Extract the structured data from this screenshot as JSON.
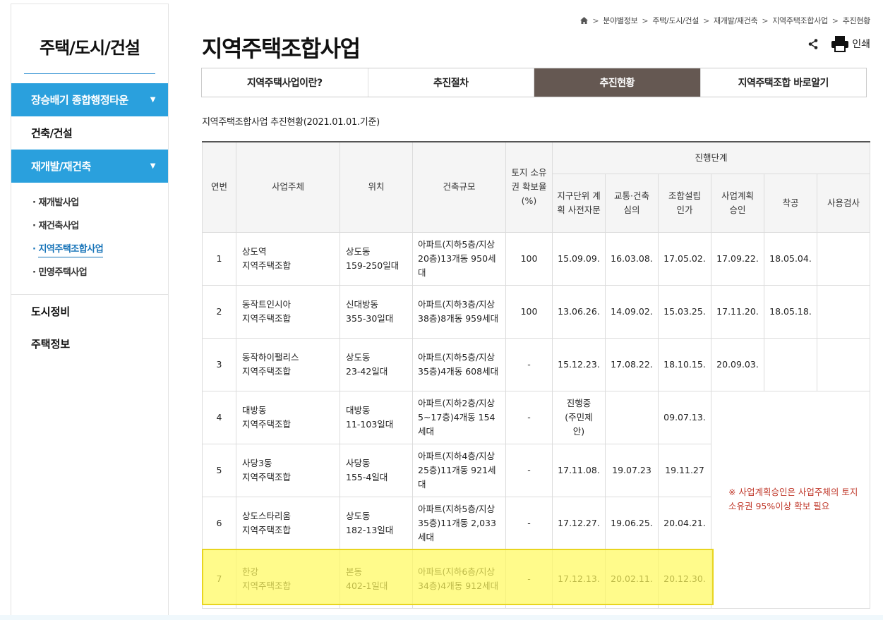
{
  "sidebar": {
    "title": "주택/도시/건설",
    "menu": [
      {
        "label": "장승배기 종합행정타운",
        "caret": "▼"
      },
      {
        "label": "건축/건설"
      },
      {
        "label": "재개발/재건축",
        "caret": "▼"
      }
    ],
    "submenu": [
      "재개발사업",
      "재건축사업",
      "지역주택조합사업",
      "민영주택사업"
    ],
    "bottom": [
      "도시정비",
      "주택정보"
    ]
  },
  "breadcrumb": [
    "분야별정보",
    "주택/도시/건설",
    "재개발/재건축",
    "지역주택조합사업",
    "추진현황"
  ],
  "page_title": "지역주택조합사업",
  "tools": {
    "print_label": "인쇄"
  },
  "tabs": [
    "지역주택사업이란?",
    "추진절차",
    "추진현황",
    "지역주택조합 바로알기"
  ],
  "caption": "지역주택조합사업 추진현황(2021.01.01.기준)",
  "table": {
    "headers": {
      "no": "연번",
      "owner": "사업주체",
      "location": "위치",
      "scale": "건축규모",
      "land": "토지 소유권 확보율 (%)",
      "stage": "진행단계",
      "stages": [
        "지구단위 계획 사전자문",
        "교통·건축 심의",
        "조합설립 인가",
        "사업계획 승인",
        "착공",
        "사용검사"
      ]
    },
    "rows": [
      {
        "no": "1",
        "owner1": "상도역",
        "owner2": "지역주택조합",
        "loc1": "상도동",
        "loc2": "159-250일대",
        "scale": "아파트(지하5층/지상20층)13개동 950세대",
        "land": "100",
        "s1": "15.09.09.",
        "s2": "16.03.08.",
        "s3": "17.05.02.",
        "s4": "17.09.22.",
        "s5": "18.05.04.",
        "s6": ""
      },
      {
        "no": "2",
        "owner1": "동작트인시아",
        "owner2": "지역주택조합",
        "loc1": "신대방동",
        "loc2": "355-30일대",
        "scale": "아파트(지하3층/지상38층)8개동 959세대",
        "land": "100",
        "s1": "13.06.26.",
        "s2": "14.09.02.",
        "s3": "15.03.25.",
        "s4": "17.11.20.",
        "s5": "18.05.18.",
        "s6": ""
      },
      {
        "no": "3",
        "owner1": "동작하이팰리스",
        "owner2": "지역주택조합",
        "loc1": "상도동",
        "loc2": "23-42일대",
        "scale": "아파트(지하5층/지상35층)4개동 608세대",
        "land": "-",
        "s1": "15.12.23.",
        "s2": "17.08.22.",
        "s3": "18.10.15.",
        "s4": "20.09.03.",
        "s5": "",
        "s6": ""
      },
      {
        "no": "4",
        "owner1": "대방동",
        "owner2": "지역주택조합",
        "loc1": "대방동",
        "loc2": "11-103일대",
        "scale": "아파트(지하2층/지상5~17층)4개동 154세대",
        "land": "-",
        "s1": "진행중 (주민제안)",
        "s2": "",
        "s3": "09.07.13."
      },
      {
        "no": "5",
        "owner1": "사당3동",
        "owner2": "지역주택조합",
        "loc1": "사당동",
        "loc2": "155-4일대",
        "scale": "아파트(지하4층/지상25층)11개동 921세대",
        "land": "-",
        "s1": "17.11.08.",
        "s2": "19.07.23",
        "s3": "19.11.27"
      },
      {
        "no": "6",
        "owner1": "상도스타리움",
        "owner2": "지역주택조합",
        "loc1": "상도동",
        "loc2": "182-13일대",
        "scale": "아파트(지하5층/지상35층)11개동 2,033세대",
        "land": "-",
        "s1": "17.12.27.",
        "s2": "19.06.25.",
        "s3": "20.04.21."
      },
      {
        "no": "7",
        "owner1": "한강",
        "owner2": "지역주택조합",
        "loc1": "본동",
        "loc2": "402-1일대",
        "scale": "아파트(지하6층/지상34층)4개동 912세대",
        "land": "-",
        "s1": "17.12.13.",
        "s2": "20.02.11.",
        "s3": "20.12.30."
      }
    ],
    "note": "※ 사업계획승인은 사업주체의 토지소유권 95%이상 확보 필요"
  },
  "colors": {
    "sidebar_blue": "#2aa0dd",
    "active_tab": "#655852",
    "note_red": "#c0392b",
    "highlight": "#fff95a"
  }
}
